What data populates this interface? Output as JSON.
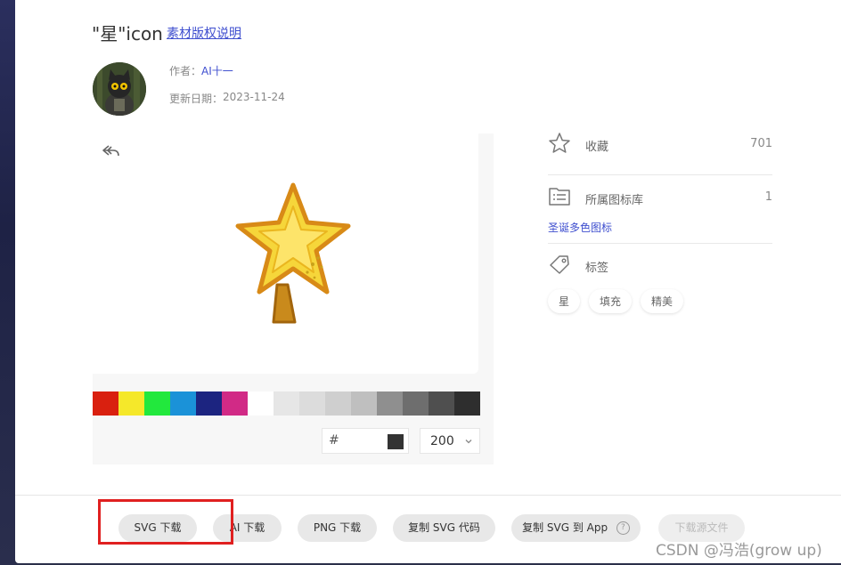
{
  "icon": {
    "title": "\"星\"icon",
    "copyright_link": "素材版权说明",
    "author_label": "作者：",
    "author_name": "AI十一",
    "update_label": "更新日期：",
    "update_date": "2023-11-24"
  },
  "preview": {
    "swatches": [
      "#d9200f",
      "#f5e82a",
      "#22e83d",
      "#1b92d8",
      "#1c2480",
      "#d12a86",
      "#ffffff",
      "#e6e6e6",
      "#dcdcdc",
      "#cfcfcf",
      "#bfbfbf",
      "#8f8f8f",
      "#6e6e6e",
      "#4f4f4f",
      "#2e2e2e"
    ],
    "hex_prefix": "#",
    "hex_value": "#333333",
    "size_value": "200"
  },
  "side": {
    "favorites_label": "收藏",
    "favorites_count": "701",
    "library_label": "所属图标库",
    "library_count": "1",
    "library_link": "圣诞多色图标",
    "tags_label": "标签",
    "tags": [
      "星",
      "填充",
      "精美"
    ]
  },
  "actions": {
    "svg_download": "SVG 下载",
    "ai_download": "AI 下载",
    "png_download": "PNG 下载",
    "copy_svg_code": "复制 SVG 代码",
    "copy_svg_to_app": "复制 SVG 到 App",
    "help_glyph": "?",
    "download_source": "下载源文件"
  },
  "watermark": "CSDN @冯浩(grow up)"
}
